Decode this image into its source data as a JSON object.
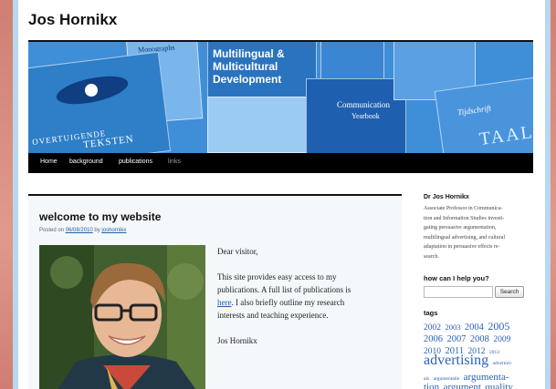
{
  "site": {
    "title": "Jos Hornikx"
  },
  "banner": {
    "books": [
      "Monographs",
      "Multilingual &",
      "Multicultural",
      "Development",
      "OVERTUIGENDE",
      "TEKSTEN",
      "Communication",
      "Yearbook",
      "Tijdschrift",
      "TAAL"
    ]
  },
  "nav": {
    "items": [
      {
        "label": "Home"
      },
      {
        "label": "background"
      },
      {
        "label": "publications"
      },
      {
        "label": "links"
      }
    ]
  },
  "post": {
    "title": "welcome to my website",
    "posted_prefix": "Posted on",
    "date": "06/08/2010",
    "by": "by",
    "author": "joshornikx",
    "greeting": "Dear visitor,",
    "line1": "This site provides easy access to my",
    "line2": "publications. A full list of publications is",
    "link_here": "here",
    "line3_rest": ". I also briefly outline my research",
    "line4": "interests and teaching experience.",
    "signature": "Jos Hornikx"
  },
  "sidebar": {
    "name": "Dr Jos Hornikx",
    "bio": [
      "Associate Professor in Communica-",
      "tion and Information Studies investi-",
      "gating persuasive argumentation,",
      "multilingual advertising, and cultural",
      "adaptation in persuasive effects re-",
      "search."
    ],
    "help_heading": "how can I help you?",
    "search_placeholder": "",
    "search_button": "Search",
    "tags_heading": "tags",
    "tags": [
      [
        {
          "t": "2002",
          "s": 9.5
        },
        {
          "t": "2003",
          "s": 8.5
        },
        {
          "t": "2004",
          "s": 10.5
        },
        {
          "t": "2005",
          "s": 12
        }
      ],
      [
        {
          "t": "2006",
          "s": 10.5
        },
        {
          "t": "2007",
          "s": 10.5
        },
        {
          "t": "2008",
          "s": 10.5
        },
        {
          "t": "2009",
          "s": 9.5
        }
      ],
      [
        {
          "t": "2010",
          "s": 9.5
        },
        {
          "t": "2011",
          "s": 10.5
        },
        {
          "t": "2012",
          "s": 9.5
        },
        {
          "t": "2013",
          "s": 5.5
        }
      ],
      [
        {
          "t": "advertising",
          "s": 16
        },
        {
          "t": "advertori-",
          "s": 5.5
        }
      ],
      [
        {
          "t": "als",
          "s": 5.5
        },
        {
          "t": "argumentatie",
          "s": 5.5
        },
        {
          "t": "argumenta-",
          "s": 11
        }
      ],
      [
        {
          "t": "tion",
          "s": 11
        },
        {
          "t": "argument",
          "s": 11
        },
        {
          "t": "quality",
          "s": 11
        }
      ]
    ]
  },
  "colors": {
    "background": "#d98a7e",
    "banner": "#3f8ed8",
    "link": "#2a62b4",
    "navbar": "#000000"
  }
}
